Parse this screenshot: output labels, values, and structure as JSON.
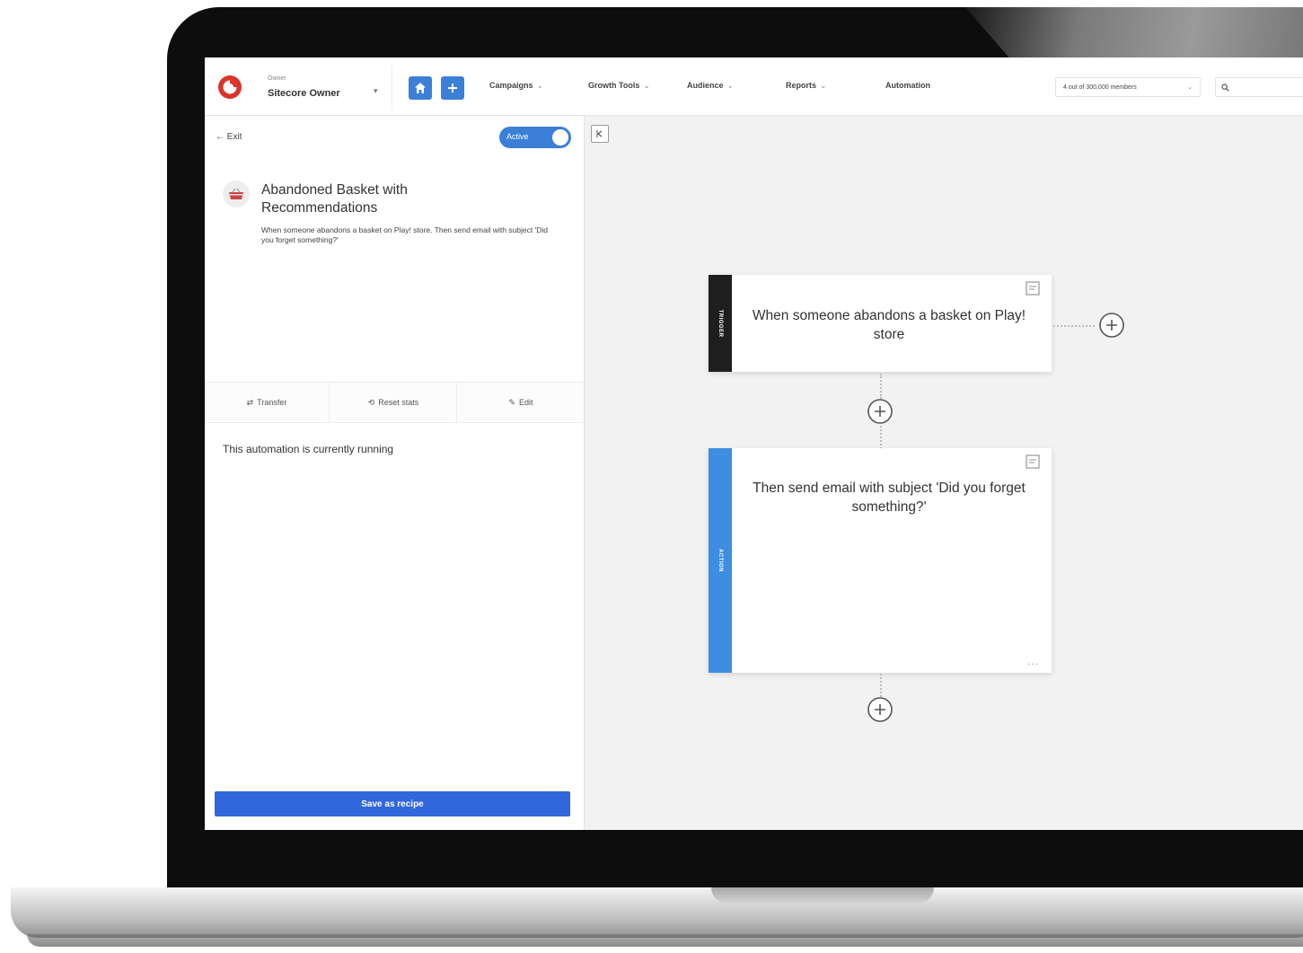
{
  "header": {
    "owner_caption": "Owner",
    "owner_name": "Sitecore Owner",
    "nav": [
      {
        "label": "Campaigns",
        "has_dropdown": true
      },
      {
        "label": "Growth Tools",
        "has_dropdown": true
      },
      {
        "label": "Audience",
        "has_dropdown": true
      },
      {
        "label": "Reports",
        "has_dropdown": true
      },
      {
        "label": "Automation",
        "has_dropdown": false
      }
    ],
    "members": "4 out of 300,000 members",
    "search_placeholder": ""
  },
  "left_panel": {
    "exit_label": "Exit",
    "toggle_label": "Active",
    "toggle_on": true,
    "automation_title": "Abandoned Basket with Recommendations",
    "automation_description": "When someone abandons a basket on Play! store. Then send email with subject 'Did you forget something?'",
    "actions": [
      {
        "icon": "transfer-icon",
        "label": "Transfer"
      },
      {
        "icon": "reset-icon",
        "label": "Reset stats"
      },
      {
        "icon": "pencil-icon",
        "label": "Edit"
      }
    ],
    "status_text": "This automation is currently running",
    "save_recipe_label": "Save as recipe"
  },
  "canvas": {
    "trigger": {
      "strip_label": "TRIGGER",
      "text": "When someone abandons a basket on Play! store"
    },
    "action": {
      "strip_label": "ACTION",
      "text": "Then send email with subject 'Did you forget something?'",
      "more_label": "..."
    }
  },
  "colors": {
    "accent": "#3b7fd9",
    "save_button": "#3266dc",
    "trigger_strip": "#1e1e1e",
    "action_strip": "#3d8ee0",
    "logo_red": "#d9342b"
  }
}
